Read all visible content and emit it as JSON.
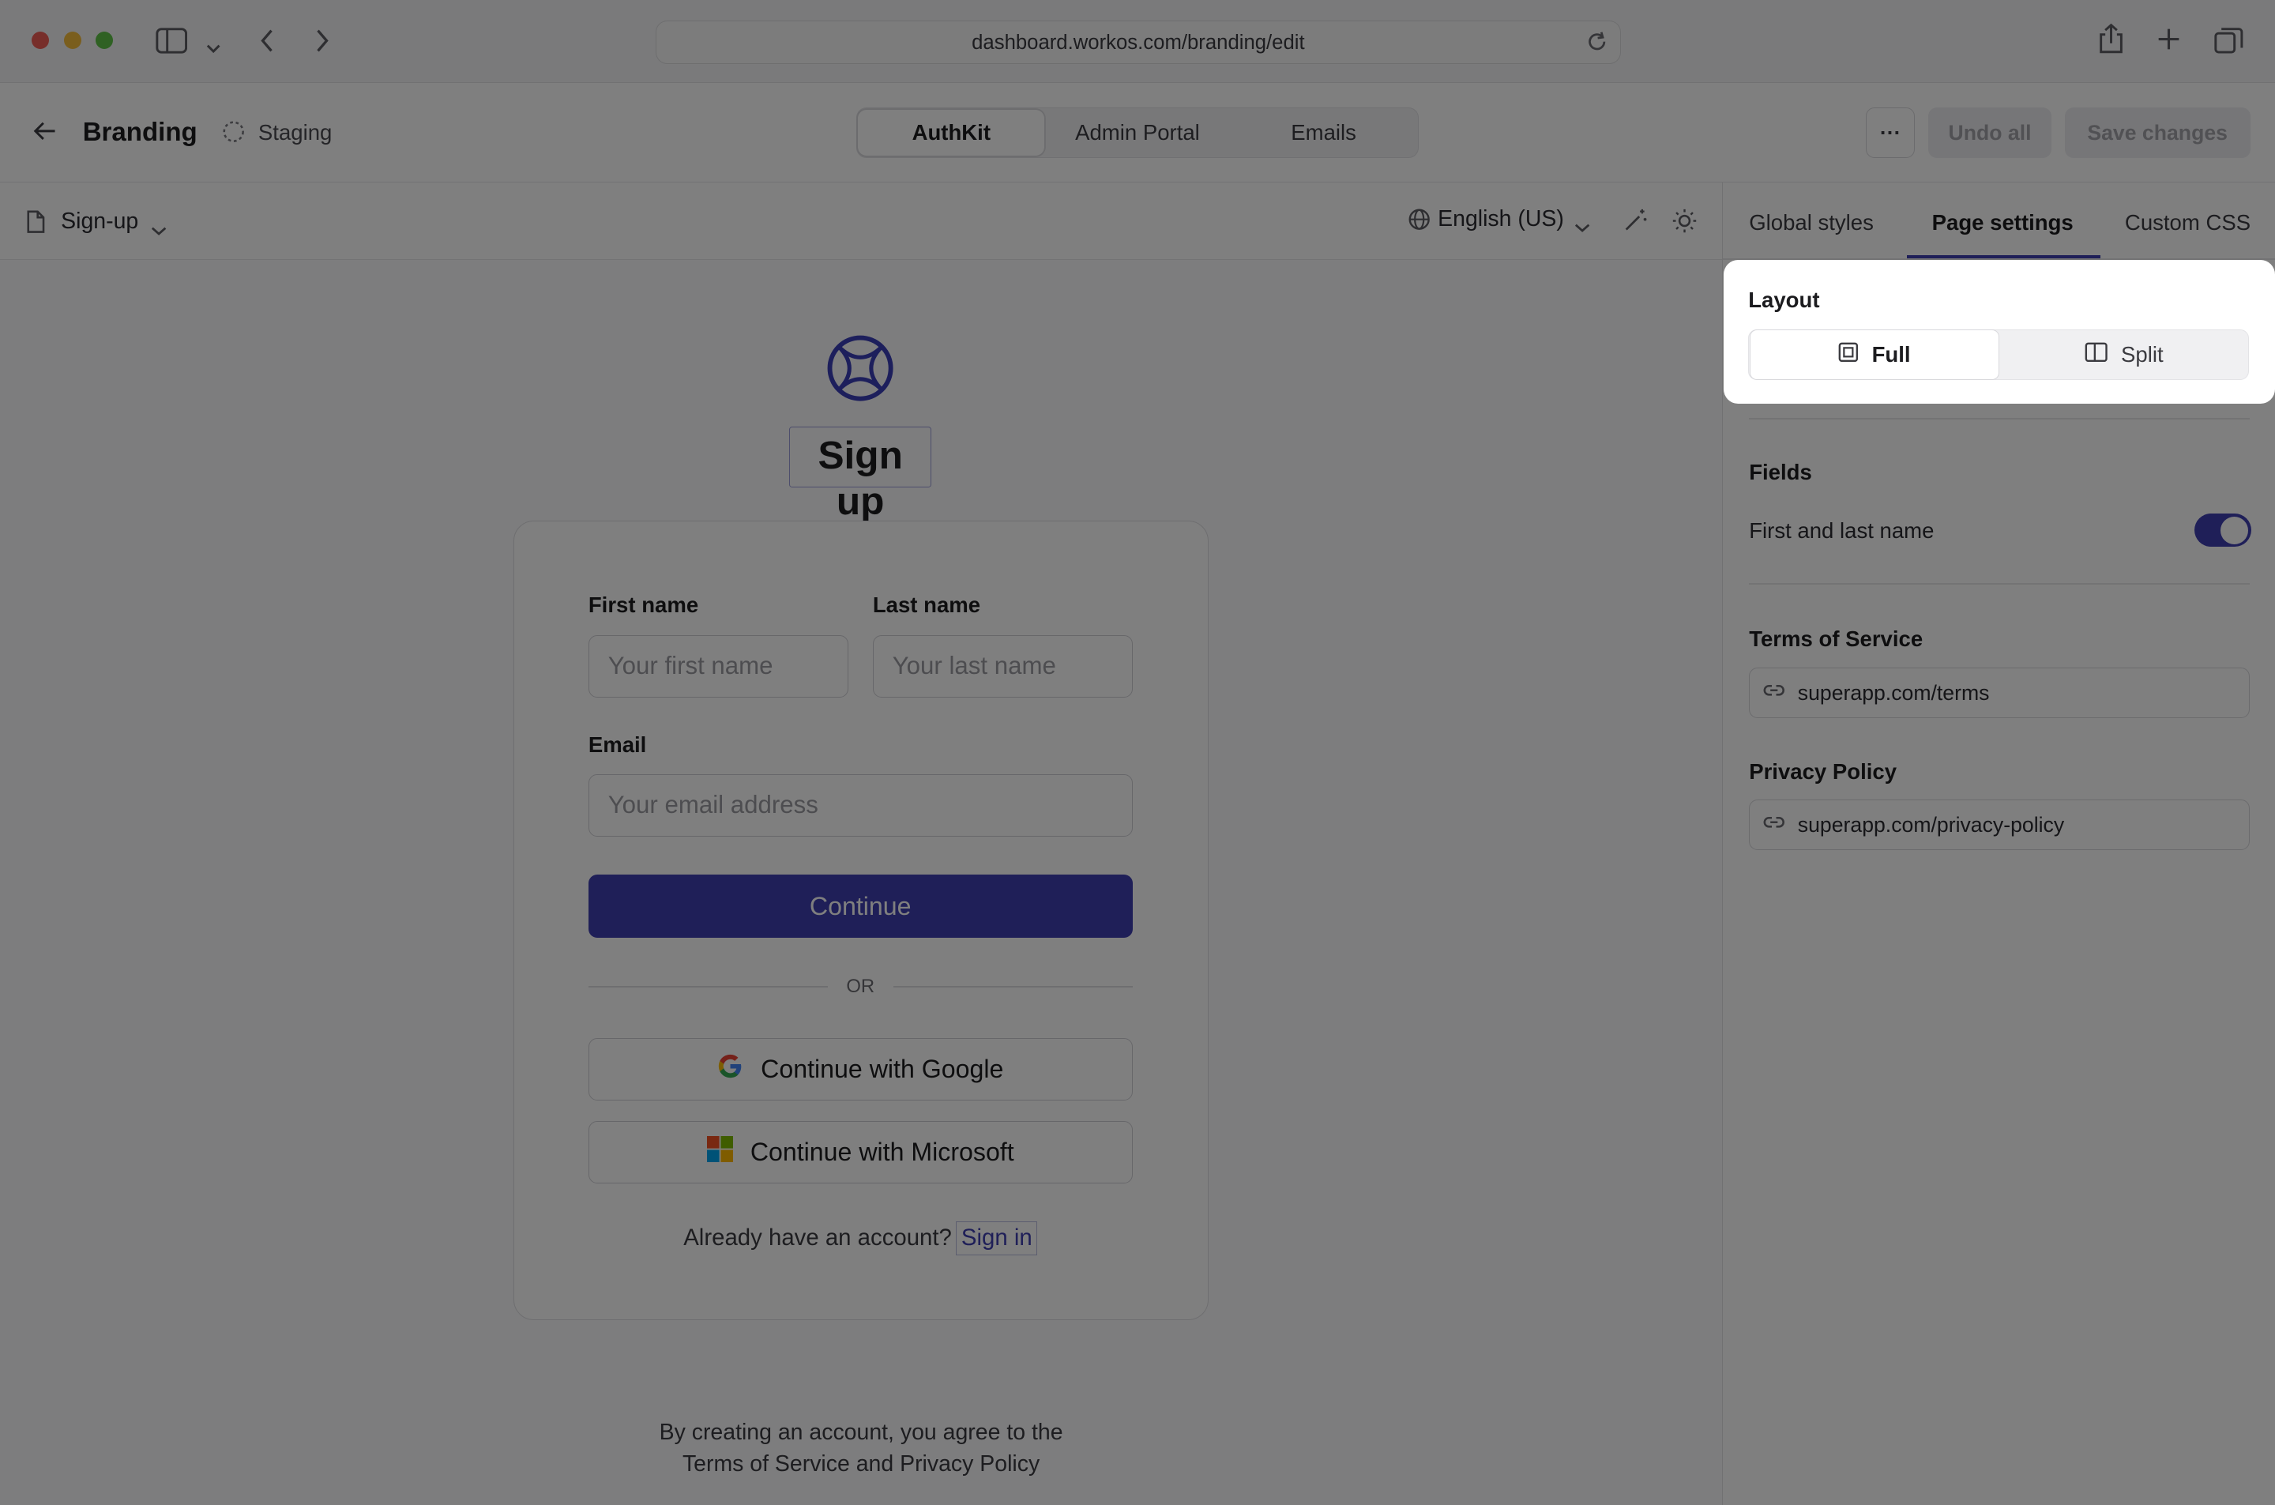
{
  "browser": {
    "url": "dashboard.workos.com/branding/edit"
  },
  "header": {
    "title": "Branding",
    "environment": "Staging",
    "tabs": [
      {
        "label": "AuthKit",
        "active": true
      },
      {
        "label": "Admin Portal",
        "active": false
      },
      {
        "label": "Emails",
        "active": false
      }
    ],
    "more_label": "···",
    "undo_label": "Undo all",
    "save_label": "Save changes"
  },
  "toolbar": {
    "page_selector": "Sign-up",
    "language": "English (US)"
  },
  "preview": {
    "title": "Sign up",
    "first_name_label": "First name",
    "first_name_placeholder": "Your first name",
    "last_name_label": "Last name",
    "last_name_placeholder": "Your last name",
    "email_label": "Email",
    "email_placeholder": "Your email address",
    "continue_label": "Continue",
    "divider_text": "OR",
    "google_label": "Continue with Google",
    "microsoft_label": "Continue with Microsoft",
    "account_prompt": "Already have an account?",
    "sign_in_label": "Sign in",
    "legal_line1": "By creating an account, you agree to the",
    "legal_line2": "Terms of Service and Privacy Policy",
    "accent_color": "#3f3fb0"
  },
  "panel": {
    "tabs": [
      {
        "label": "Global styles",
        "active": false
      },
      {
        "label": "Page settings",
        "active": true
      },
      {
        "label": "Custom CSS",
        "active": false
      }
    ],
    "layout": {
      "title": "Layout",
      "options": [
        {
          "label": "Full",
          "selected": true
        },
        {
          "label": "Split",
          "selected": false
        }
      ]
    },
    "fields": {
      "title": "Fields",
      "first_last_name_label": "First and last name",
      "first_last_name_enabled": true
    },
    "terms": {
      "title": "Terms of Service",
      "value": "superapp.com/terms"
    },
    "privacy": {
      "title": "Privacy Policy",
      "value": "superapp.com/privacy-policy"
    }
  }
}
